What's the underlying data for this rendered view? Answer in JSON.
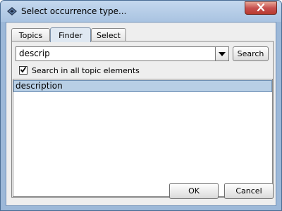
{
  "window": {
    "title": "Select occurrence type...",
    "app_icon": "topic-map-icon",
    "close_icon": "close-icon"
  },
  "tabs": [
    {
      "label": "Topics",
      "active": false
    },
    {
      "label": "Finder",
      "active": true
    },
    {
      "label": "Select",
      "active": false
    }
  ],
  "finder": {
    "search_value": "descrip",
    "dropdown_icon": "chevron-down-icon",
    "search_button": "Search",
    "checkbox_label": "Search in all topic elements",
    "checkbox_checked": true,
    "results": [
      "description"
    ],
    "selected_result": "description"
  },
  "buttons": {
    "ok": "OK",
    "cancel": "Cancel"
  },
  "colors": {
    "selection": "#b8cfe5",
    "active_tab": "#dfe8f2",
    "close_button": "#c75050"
  }
}
